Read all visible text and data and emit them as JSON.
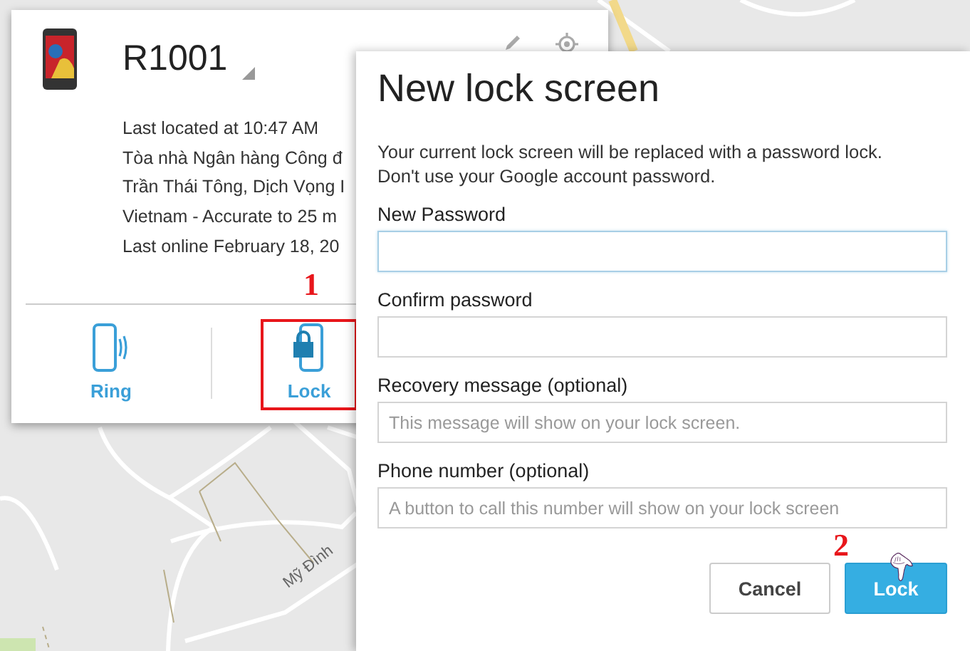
{
  "map": {
    "labels": [
      {
        "text": "Mỹ Đình"
      }
    ]
  },
  "device": {
    "name": "R1001",
    "info": [
      "Last located at 10:47 AM",
      "Tòa nhà Ngân hàng Công đ",
      "Trần Thái Tông, Dịch Vọng I",
      "Vietnam - Accurate to 25 m",
      "Last online February 18, 20"
    ],
    "actions": [
      {
        "kind": "ring",
        "label": "Ring",
        "highlighted": false
      },
      {
        "kind": "lock",
        "label": "Lock",
        "highlighted": true
      }
    ]
  },
  "annotations": [
    {
      "text": "1"
    },
    {
      "text": "2"
    }
  ],
  "dialog": {
    "title": "New lock screen",
    "description": "Your current lock screen will be replaced with a password lock. Don't use your Google account password.",
    "fields": [
      {
        "label": "New Password",
        "focused": true
      },
      {
        "label": "Confirm password",
        "focused": false
      },
      {
        "label": "Recovery message (optional)",
        "placeholder": "This message will show on your lock screen.",
        "focused": false
      },
      {
        "label": "Phone number (optional)",
        "placeholder": "A button to call this number will show on your lock screen",
        "focused": false
      }
    ],
    "buttons": [
      {
        "kind": "secondary",
        "label": "Cancel"
      },
      {
        "kind": "primary",
        "label": "Lock"
      }
    ]
  }
}
